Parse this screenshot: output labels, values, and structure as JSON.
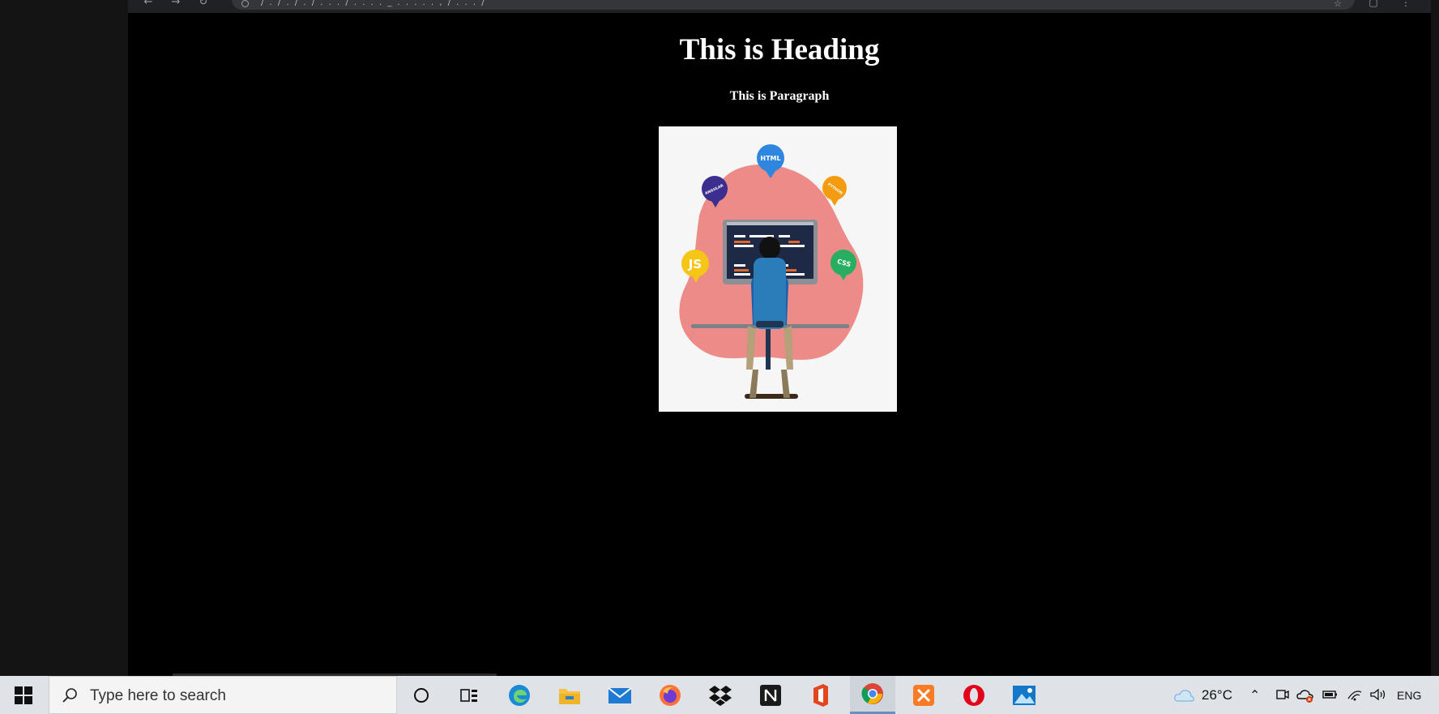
{
  "browser": {
    "url": "/ . / . / . / . . . / . . . . _ . . . . . , / . . . /"
  },
  "page": {
    "heading": "This is Heading",
    "paragraph": "This is Paragraph",
    "illustration_badges": [
      "HTML",
      "ANGULAR",
      "PYTHON",
      "JS",
      "CSS"
    ]
  },
  "taskbar": {
    "search_placeholder": "Type here to search",
    "apps": [
      "cortana-icon",
      "task-view-icon",
      "edge-icon",
      "file-explorer-icon",
      "mail-icon",
      "firefox-icon",
      "dropbox-icon",
      "notion-icon",
      "office-icon",
      "chrome-icon",
      "xampp-icon",
      "opera-icon",
      "photos-icon"
    ],
    "temperature": "26°C",
    "language": "ENG"
  },
  "colors": {
    "page_bg": "#000000",
    "taskbar_bg": "#dfe3e8",
    "blob": "#ec8b87"
  }
}
